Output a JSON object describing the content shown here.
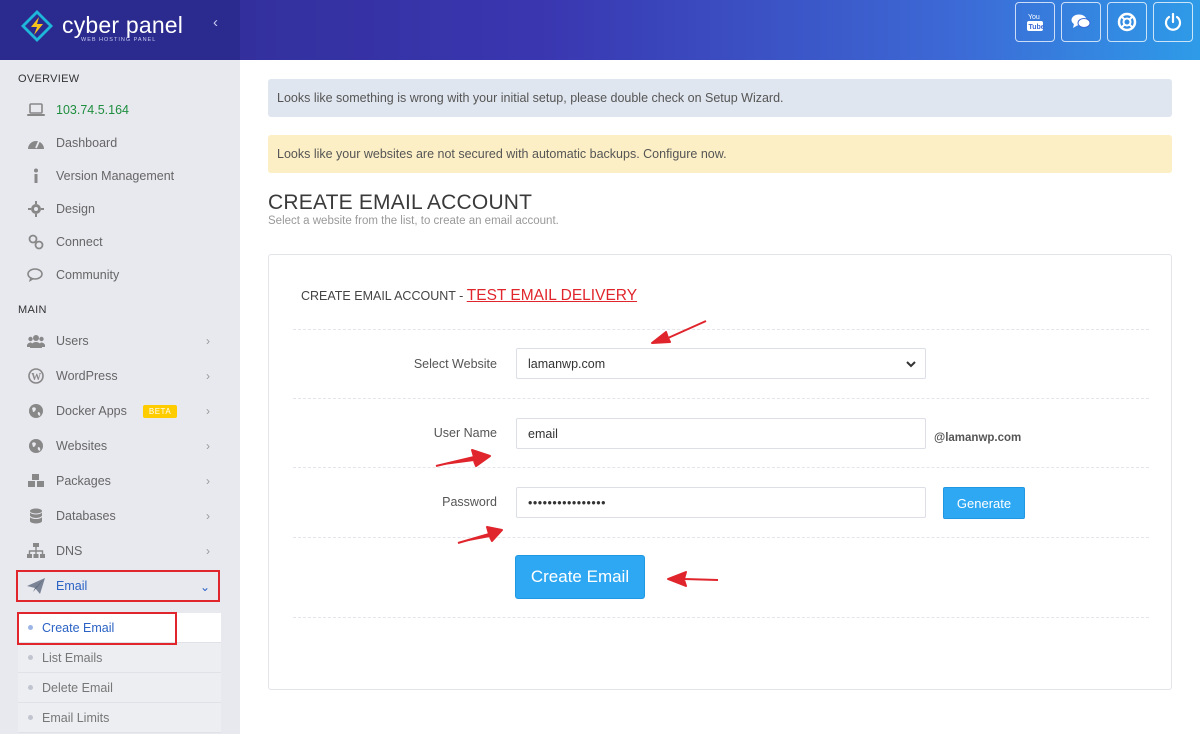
{
  "app": {
    "brand_name": "cyber panel",
    "brand_tagline": "WEB HOSTING PANEL"
  },
  "topbar": {
    "buttons": [
      "youtube-icon",
      "chat-icon",
      "support-icon",
      "power-icon"
    ]
  },
  "sidebar": {
    "overview_label": "OVERVIEW",
    "main_label": "MAIN",
    "overview_items": [
      {
        "label": "103.74.5.164",
        "icon": "laptop-icon"
      },
      {
        "label": "Dashboard",
        "icon": "dashboard-icon"
      },
      {
        "label": "Version Management",
        "icon": "info-icon"
      },
      {
        "label": "Design",
        "icon": "gear-icon"
      },
      {
        "label": "Connect",
        "icon": "link-icon"
      },
      {
        "label": "Community",
        "icon": "comments-icon"
      }
    ],
    "main_items": [
      {
        "label": "Users",
        "icon": "users-icon"
      },
      {
        "label": "WordPress",
        "icon": "wordpress-icon"
      },
      {
        "label": "Docker Apps",
        "icon": "globe-icon",
        "badge": "BETA"
      },
      {
        "label": "Websites",
        "icon": "globe-icon"
      },
      {
        "label": "Packages",
        "icon": "cubes-icon"
      },
      {
        "label": "Databases",
        "icon": "database-icon"
      },
      {
        "label": "DNS",
        "icon": "sitemap-icon"
      },
      {
        "label": "Email",
        "icon": "paper-plane-icon"
      }
    ],
    "email_sub_items": [
      "Create Email",
      "List Emails",
      "Delete Email",
      "Email Limits"
    ]
  },
  "alerts": {
    "setup": "Looks like something is wrong with your initial setup, please double check on Setup Wizard.",
    "backup": "Looks like your websites are not secured with automatic backups. Configure now."
  },
  "page": {
    "title": "CREATE EMAIL ACCOUNT",
    "subtitle": "Select a website from the list, to create an email account."
  },
  "form": {
    "heading": "CREATE EMAIL ACCOUNT - ",
    "heading_link": "TEST EMAIL DELIVERY",
    "website_label": "Select Website",
    "website_value": "lamanwp.com",
    "username_label": "User Name",
    "username_value": "email",
    "domain_suffix": "@lamanwp.com",
    "password_label": "Password",
    "password_value": "••••••••••••••••",
    "generate_label": "Generate",
    "submit_label": "Create Email"
  },
  "colors": {
    "accent": "#2ea8f2",
    "highlight": "#e0252c",
    "brand": "#2b2a8e"
  }
}
